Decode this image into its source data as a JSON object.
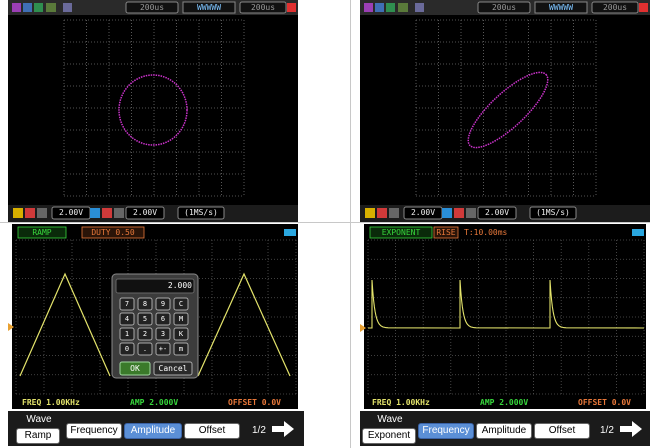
{
  "xy_top_bar": {
    "time_left": "200us",
    "waveform_text": "WWWWW",
    "time_right": "200us"
  },
  "xy_status": {
    "ch1_volts": "2.00V",
    "ch2_volts": "2.00V",
    "sample_rate": "(1MS/s)"
  },
  "xy_status_right": {
    "ch1_volts": "2.00V",
    "ch2_volts": "2.00V",
    "sample_rate": "(1MS/s)"
  },
  "ramp_panel": {
    "wave_name": "RAMP",
    "param": "DUTY 0.50",
    "freq": "FREQ 1.00KHz",
    "amp": "AMP 2.000V",
    "offset": "OFFSET 0.0V",
    "keypad_display": "2.000",
    "keys": [
      "7",
      "8",
      "9",
      "C",
      "4",
      "5",
      "6",
      "M",
      "1",
      "2",
      "3",
      "K",
      "0",
      ".",
      "+-",
      "m"
    ],
    "ok": "OK",
    "cancel": "Cancel",
    "softkeys": {
      "wave_title": "Wave",
      "wave_value": "Ramp",
      "frequency": "Frequency",
      "amplitude": "Amplitude",
      "offset": "Offset",
      "page": "1/2"
    }
  },
  "exp_panel": {
    "wave_name": "EXPONENT",
    "param": "RISE",
    "time": "T:10.00ms",
    "freq": "FREQ 1.00KHz",
    "amp": "AMP 2.000V",
    "offset": "OFFSET 0.0V",
    "softkeys": {
      "wave_title": "Wave",
      "wave_value": "Exponent",
      "frequency": "Frequency",
      "amplitude": "Amplitude",
      "offset": "Offset",
      "page": "1/2"
    }
  },
  "colors": {
    "trace_xy": "#cc33cc",
    "trace_gen": "#e3e36b",
    "grid": "#6e6e6e",
    "accent_green": "#37d63c",
    "accent_orange": "#e8783a"
  }
}
